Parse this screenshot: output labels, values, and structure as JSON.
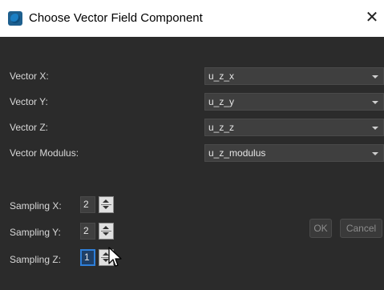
{
  "window": {
    "title": "Choose Vector Field Component",
    "close_glyph": "✕",
    "icon": "app-icon"
  },
  "fields": [
    {
      "label": "Vector X:",
      "value": "u_z_x"
    },
    {
      "label": "Vector Y:",
      "value": "u_z_y"
    },
    {
      "label": "Vector Z:",
      "value": "u_z_z"
    },
    {
      "label": "Vector Modulus:",
      "value": "u_z_modulus"
    }
  ],
  "sampling": [
    {
      "label": "Sampling X:",
      "value": "2"
    },
    {
      "label": "Sampling Y:",
      "value": "2"
    },
    {
      "label": "Sampling Z:",
      "value": "1"
    }
  ],
  "buttons": {
    "ok": "OK",
    "cancel": "Cancel"
  },
  "colors": {
    "background": "#2b2b2b",
    "focus_accent": "#2e7fd9",
    "text": "#d8d8d8"
  }
}
